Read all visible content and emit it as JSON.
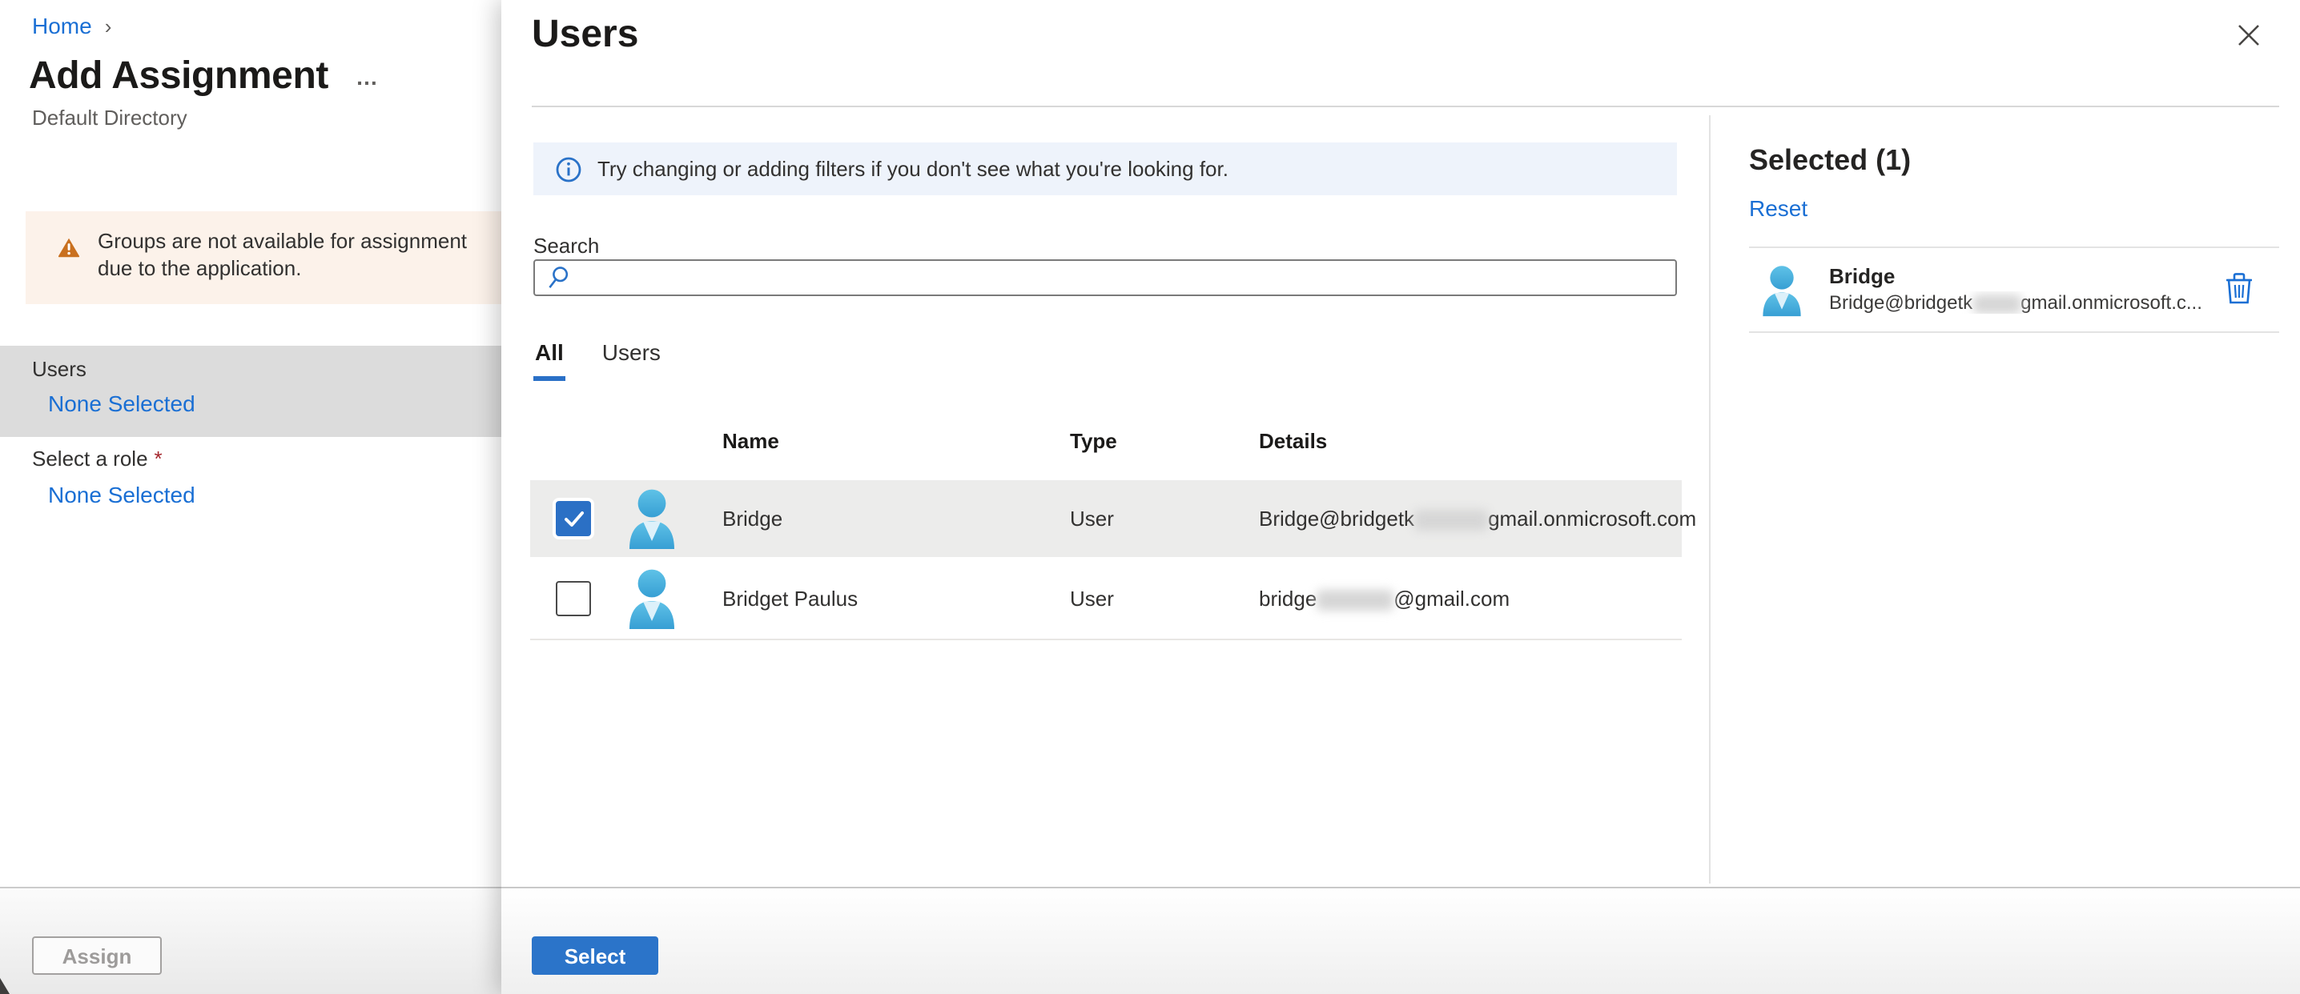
{
  "breadcrumb": {
    "home": "Home",
    "separator": "›"
  },
  "page": {
    "title": "Add Assignment",
    "subtitle": "Default Directory"
  },
  "left_panel": {
    "warning_text": "Groups are not available for assignment due to the application.",
    "users_label": "Users",
    "users_value": "None Selected",
    "role_label": "Select a role",
    "role_required_mark": "*",
    "role_value": "None Selected",
    "assign_button": "Assign"
  },
  "flyout": {
    "title": "Users",
    "info_banner": "Try changing or adding filters if you don't see what you're looking for.",
    "search_label": "Search",
    "search_value": "",
    "tabs": [
      {
        "label": "All",
        "active": true
      },
      {
        "label": "Users",
        "active": false
      }
    ],
    "table": {
      "columns": [
        "Name",
        "Type",
        "Details"
      ],
      "rows": [
        {
          "checked": true,
          "name": "Bridge",
          "type": "User",
          "details_prefix": "Bridge@bridgetk",
          "details_redacted": true,
          "details_suffix": "gmail.onmicrosoft.com"
        },
        {
          "checked": false,
          "name": "Bridget Paulus",
          "type": "User",
          "details_prefix": "bridge",
          "details_redacted": true,
          "details_suffix": "@gmail.com"
        }
      ]
    },
    "select_button": "Select"
  },
  "selected_panel": {
    "title": "Selected (1)",
    "reset_link": "Reset",
    "items": [
      {
        "name": "Bridge",
        "email_prefix": "Bridge@bridgetk",
        "email_redacted": true,
        "email_suffix": "gmail.onmicrosoft.c..."
      }
    ]
  },
  "icons": {
    "more_options": "…",
    "breadcrumb_separator": "›",
    "close": "✕",
    "warning": "warning-triangle",
    "info": "info-circle",
    "search": "magnifier",
    "trash": "trash-can",
    "user_avatar": "person-silhouette"
  },
  "colors": {
    "accent_blue": "#2b74c9",
    "link_blue": "#1a6fd4",
    "warning_bg": "#fcf2ea",
    "warning_icon": "#c9701f",
    "info_banner_bg": "#eef3fb",
    "selected_row_bg": "#ececeb",
    "highlight_band_bg": "#dcdcdc",
    "required_mark": "#a4262c"
  }
}
